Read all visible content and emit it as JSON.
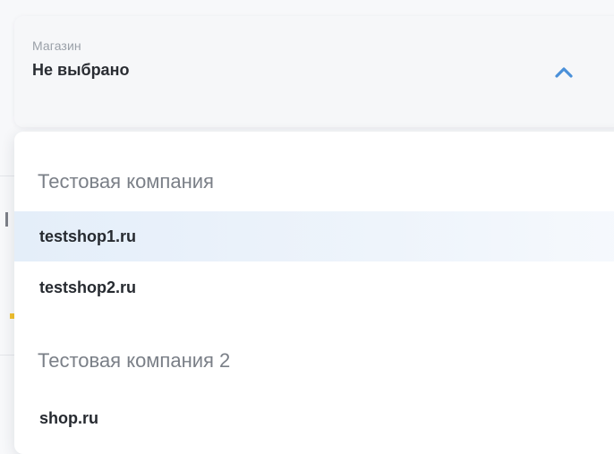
{
  "store_select": {
    "caption": "Магазин",
    "value": "Не выбрано",
    "toggle_icon": "chevron-up-icon",
    "accent_color": "#4a90d9"
  },
  "dropdown": {
    "groups": [
      {
        "heading": "Тестовая компания",
        "options": [
          {
            "label": "testshop1.ru",
            "highlighted": true
          },
          {
            "label": "testshop2.ru",
            "highlighted": false
          }
        ]
      },
      {
        "heading": "Тестовая компания 2",
        "options": [
          {
            "label": "shop.ru",
            "highlighted": false
          }
        ]
      }
    ],
    "highlight_color": "#e8f1fb"
  }
}
